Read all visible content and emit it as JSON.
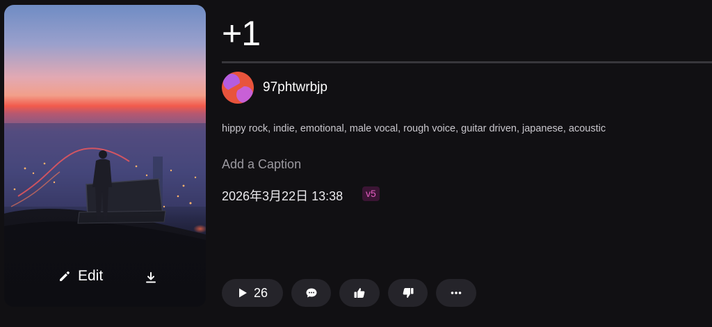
{
  "song": {
    "title": "+1",
    "author": "97phtwrbjp",
    "tags": "hippy rock, indie, emotional, male vocal, rough voice, guitar driven, japanese, acoustic",
    "caption_placeholder": "Add a Caption",
    "created": "2026年3月22日 13:38",
    "version": "v5"
  },
  "cover": {
    "edit_label": "Edit",
    "icons": {
      "edit": "pencil-icon",
      "download": "download-icon"
    }
  },
  "actions": {
    "play_count": "26",
    "icons": {
      "play": "play-icon",
      "comment": "comment-icon",
      "like": "thumbs-up-icon",
      "dislike": "thumbs-down-icon",
      "more": "more-icon"
    }
  },
  "colors": {
    "background": "#111013",
    "pill": "#25242a",
    "version_text": "#e35ec0",
    "version_bg": "#3b1534"
  }
}
